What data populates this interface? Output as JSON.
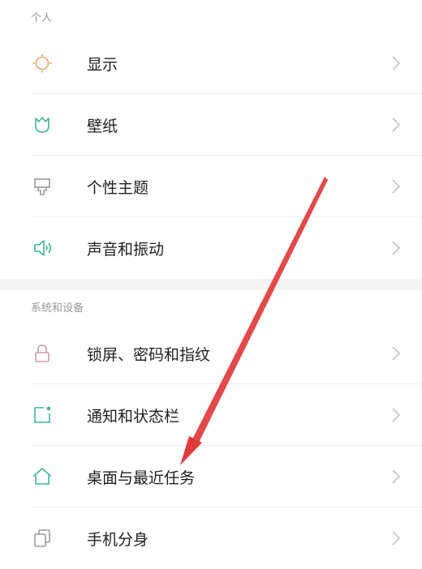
{
  "sections": [
    {
      "header": "个人",
      "items": [
        {
          "label": "显示",
          "icon": "sun-icon",
          "icon_color": "#e8a66a"
        },
        {
          "label": "壁纸",
          "icon": "tulip-icon",
          "icon_color": "#3fb59a"
        },
        {
          "label": "个性主题",
          "icon": "brush-icon",
          "icon_color": "#9a9a9a"
        },
        {
          "label": "声音和振动",
          "icon": "speaker-icon",
          "icon_color": "#3fb59a"
        }
      ]
    },
    {
      "header": "系统和设备",
      "items": [
        {
          "label": "锁屏、密码和指纹",
          "icon": "lock-icon",
          "icon_color": "#d29aa5"
        },
        {
          "label": "通知和状态栏",
          "icon": "notification-icon",
          "icon_color": "#3fb59a"
        },
        {
          "label": "桌面与最近任务",
          "icon": "home-icon",
          "icon_color": "#3fb59a"
        },
        {
          "label": "手机分身",
          "icon": "clone-icon",
          "icon_color": "#9a9a9a"
        }
      ]
    }
  ],
  "colors": {
    "chevron": "#c4c4c4",
    "annotation_arrow": "#e03a3a"
  }
}
